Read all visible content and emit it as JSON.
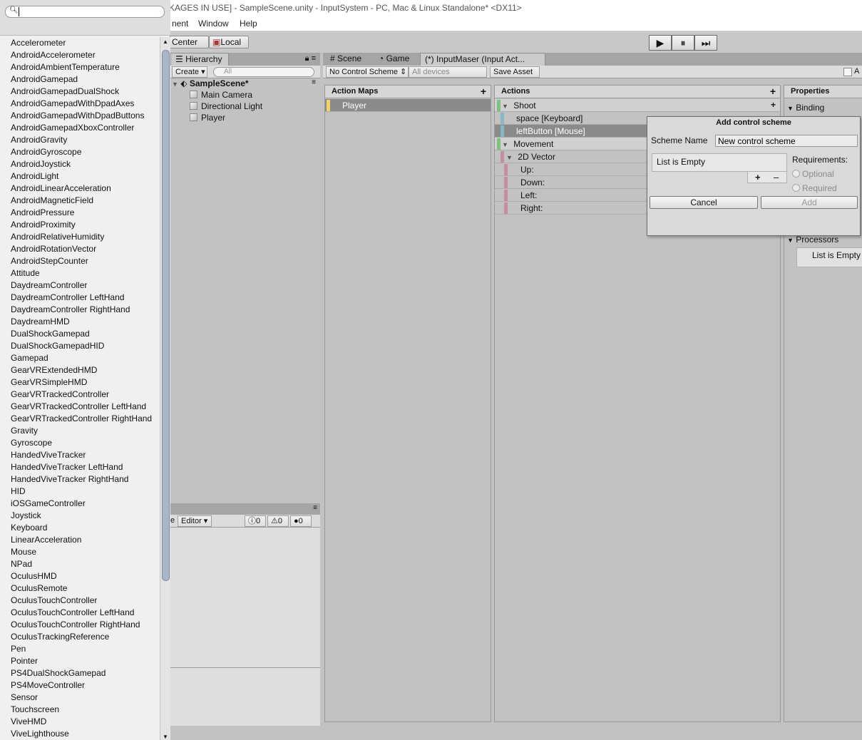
{
  "window": {
    "title": "KAGES IN USE] - SampleScene.unity - InputSystem - PC, Mac & Linux Standalone* <DX11>"
  },
  "menu": [
    "nent",
    "Window",
    "Help"
  ],
  "toolbar": {
    "center_label": "Center",
    "local_label": "Local",
    "play": "▶",
    "pause": "⏸",
    "step": "⏭"
  },
  "hierarchy": {
    "tab_label": "Hierarchy",
    "create_label": "Create",
    "search_placeholder": "All",
    "scene_name": "SampleScene*",
    "items": [
      "Main Camera",
      "Directional Light",
      "Player"
    ]
  },
  "console": {
    "editor_label": "Editor",
    "count_info": "0",
    "count_warn": "0",
    "count_error": "0",
    "cut_label": "e"
  },
  "tabs": {
    "scene": "Scene",
    "game": "Game",
    "input": "(*) InputMaser (Input Act..."
  },
  "input_editor": {
    "control_scheme": "No Control Scheme",
    "devices": "All devices",
    "save_label": "Save Asset",
    "checkbox_label": "A",
    "action_maps_title": "Action Maps",
    "action_maps": [
      "Player"
    ],
    "actions_title": "Actions",
    "actions": [
      {
        "label": "Shoot",
        "type": "action"
      },
      {
        "label": "space [Keyboard]",
        "type": "binding"
      },
      {
        "label": "leftButton [Mouse]",
        "type": "binding-selected"
      },
      {
        "label": "Movement",
        "type": "action"
      },
      {
        "label": "2D Vector",
        "type": "composite"
      },
      {
        "label": "Up:",
        "type": "part"
      },
      {
        "label": "Down:",
        "type": "part"
      },
      {
        "label": "Left:",
        "type": "part"
      },
      {
        "label": "Right:",
        "type": "part"
      }
    ],
    "properties_title": "Properties",
    "binding_label": "Binding",
    "processors_label": "Processors",
    "processors_empty": "List is Empty"
  },
  "scheme_popup": {
    "title": "Add control scheme",
    "name_label": "Scheme Name",
    "name_value": "New control scheme",
    "list_empty": "List is Empty",
    "requirements_label": "Requirements:",
    "optional_label": "Optional",
    "required_label": "Required",
    "cancel_label": "Cancel",
    "add_label": "Add",
    "plus": "+",
    "minus": "–"
  },
  "device_dropdown": {
    "search_value": "",
    "items": [
      "Accelerometer",
      "AndroidAccelerometer",
      "AndroidAmbientTemperature",
      "AndroidGamepad",
      "AndroidGamepadDualShock",
      "AndroidGamepadWithDpadAxes",
      "AndroidGamepadWithDpadButtons",
      "AndroidGamepadXboxController",
      "AndroidGravity",
      "AndroidGyroscope",
      "AndroidJoystick",
      "AndroidLight",
      "AndroidLinearAcceleration",
      "AndroidMagneticField",
      "AndroidPressure",
      "AndroidProximity",
      "AndroidRelativeHumidity",
      "AndroidRotationVector",
      "AndroidStepCounter",
      "Attitude",
      "DaydreamController",
      "DaydreamController LeftHand",
      "DaydreamController RightHand",
      "DaydreamHMD",
      "DualShockGamepad",
      "DualShockGamepadHID",
      "Gamepad",
      "GearVRExtendedHMD",
      "GearVRSimpleHMD",
      "GearVRTrackedController",
      "GearVRTrackedController LeftHand",
      "GearVRTrackedController RightHand",
      "Gravity",
      "Gyroscope",
      "HandedViveTracker",
      "HandedViveTracker LeftHand",
      "HandedViveTracker RightHand",
      "HID",
      "iOSGameController",
      "Joystick",
      "Keyboard",
      "LinearAcceleration",
      "Mouse",
      "NPad",
      "OculusHMD",
      "OculusRemote",
      "OculusTouchController",
      "OculusTouchController LeftHand",
      "OculusTouchController RightHand",
      "OculusTrackingReference",
      "Pen",
      "Pointer",
      "PS4DualShockGamepad",
      "PS4MoveController",
      "Sensor",
      "Touchscreen",
      "ViveHMD",
      "ViveLighthouse"
    ]
  }
}
